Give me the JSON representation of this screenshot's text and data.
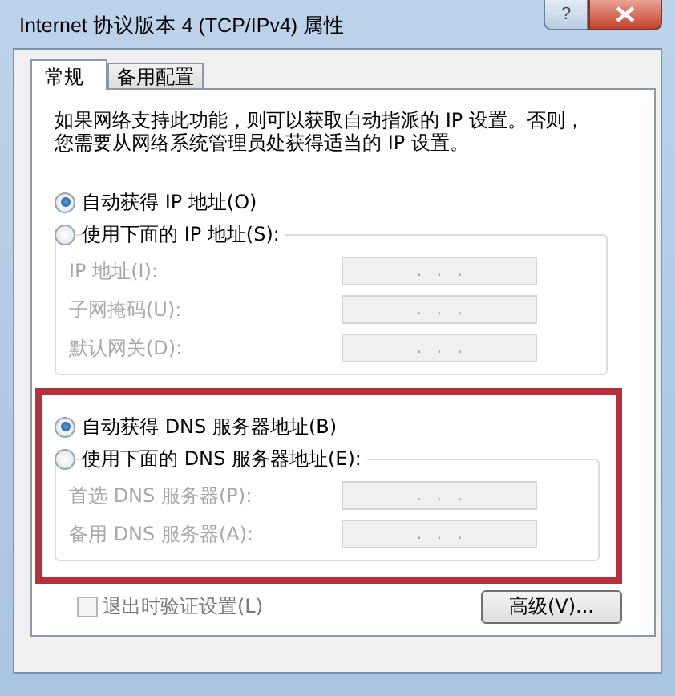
{
  "window": {
    "title": "Internet 协议版本 4 (TCP/IPv4) 属性",
    "help_button": "?"
  },
  "tabs": [
    {
      "label": "常规",
      "selected": true
    },
    {
      "label": "备用配置",
      "selected": false
    }
  ],
  "intro": [
    "如果网络支持此功能，则可以获取自动指派的 IP 设置。否则，",
    "您需要从网络系统管理员处获得适当的 IP 设置。"
  ],
  "ip": {
    "highlighted": false,
    "options": [
      {
        "label": "自动获得 IP 地址(O)",
        "selected": true
      },
      {
        "label": "使用下面的 IP 地址(S):",
        "selected": false
      }
    ],
    "fields": [
      {
        "label": "IP 地址(I):",
        "value": ".   .   .",
        "disabled": true
      },
      {
        "label": "子网掩码(U):",
        "value": ".   .   .",
        "disabled": true
      },
      {
        "label": "默认网关(D):",
        "value": ".   .   .",
        "disabled": true
      }
    ]
  },
  "dns": {
    "highlighted": true,
    "options": [
      {
        "label": "自动获得 DNS 服务器地址(B)",
        "selected": true
      },
      {
        "label": "使用下面的 DNS 服务器地址(E):",
        "selected": false
      }
    ],
    "fields": [
      {
        "label": "首选 DNS 服务器(P):",
        "value": ".   .   .",
        "disabled": true
      },
      {
        "label": "备用 DNS 服务器(A):",
        "value": ".   .   .",
        "disabled": true
      }
    ]
  },
  "validate_checkbox": {
    "label": "退出时验证设置(L)",
    "checked": false,
    "disabled": true
  },
  "advanced_button": "高级(V)..."
}
